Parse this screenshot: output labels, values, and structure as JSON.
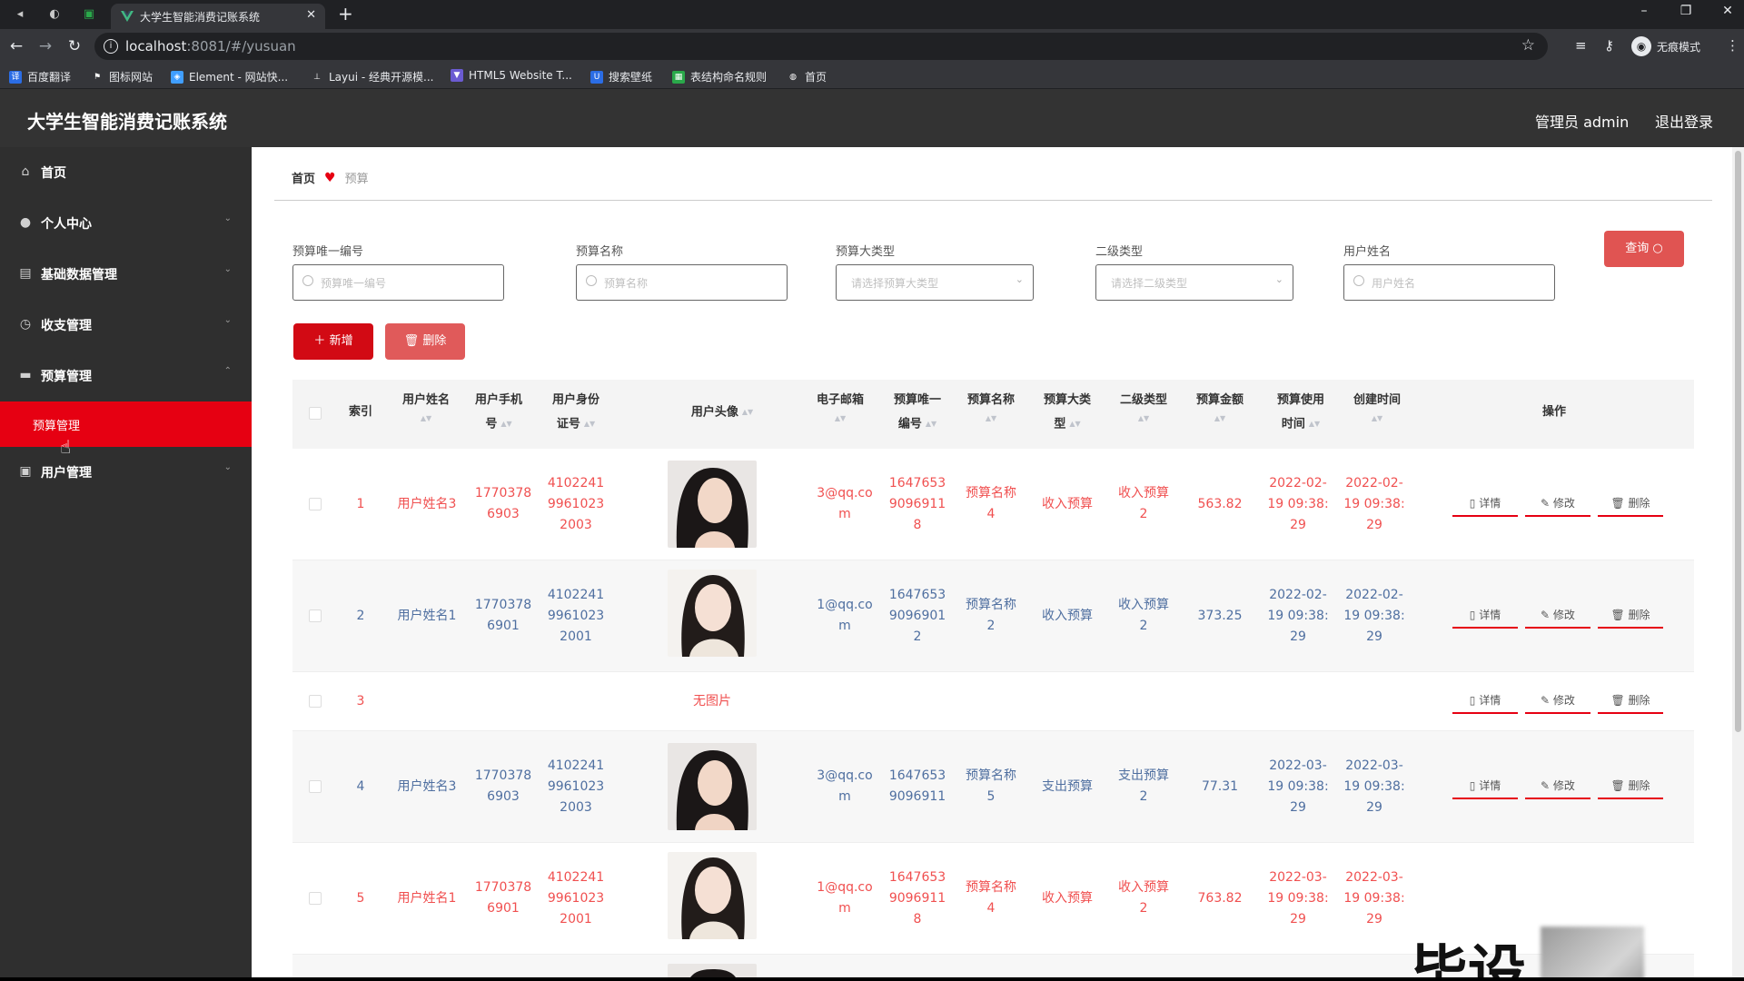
{
  "browser": {
    "tab_title": "大学生智能消费记账系统",
    "url_host": "localhost",
    "url_rest": ":8081/#/yusuan",
    "incognito_label": "无痕模式",
    "bookmarks": [
      "百度翻译",
      "图标网站",
      "Element - 网站快...",
      "Layui - 经典开源模...",
      "HTML5 Website T...",
      "搜索壁纸",
      "表结构命名规则",
      "首页"
    ]
  },
  "header": {
    "title": "大学生智能消费记账系统",
    "admin": "管理员 admin",
    "logout": "退出登录"
  },
  "sidebar": {
    "items": [
      {
        "label": "首页",
        "icon": "home-icon"
      },
      {
        "label": "个人中心",
        "icon": "user-icon"
      },
      {
        "label": "基础数据管理",
        "icon": "database-icon"
      },
      {
        "label": "收支管理",
        "icon": "clock-icon"
      },
      {
        "label": "预算管理",
        "icon": "chat-icon"
      },
      {
        "label": "用户管理",
        "icon": "user-manage-icon"
      }
    ],
    "active_sub": "预算管理"
  },
  "breadcrumb": {
    "home": "首页",
    "current": "预算"
  },
  "filters": {
    "f1_label": "预算唯一编号",
    "f1_ph": "预算唯一编号",
    "f2_label": "预算名称",
    "f2_ph": "预算名称",
    "f3_label": "预算大类型",
    "f3_ph": "请选择预算大类型",
    "f4_label": "二级类型",
    "f4_ph": "请选择二级类型",
    "f5_label": "用户姓名",
    "f5_ph": "用户姓名",
    "query": "查询"
  },
  "actions": {
    "add": "新增",
    "delete": "删除"
  },
  "table": {
    "headers": {
      "index": "索引",
      "name_1": "用户姓名",
      "phone_1": "用户手机",
      "phone_2": "号",
      "id_1": "用户身份",
      "id_2": "证号",
      "avatar": "用户头像",
      "email": "电子邮箱",
      "uid_1": "预算唯一",
      "uid_2": "编号",
      "bname": "预算名称",
      "btype_1": "预算大类",
      "btype_2": "型",
      "sub": "二级类型",
      "amount": "预算金额",
      "usetime_1": "预算使用",
      "usetime_2": "时间",
      "created": "创建时间",
      "ops": "操作"
    },
    "op_labels": {
      "detail": "详情",
      "edit": "修改",
      "delete": "删除"
    },
    "rows": [
      {
        "index": "1",
        "name": "用户姓名3",
        "phone_a": "1770378",
        "phone_b": "6903",
        "id_a": "4102241",
        "id_b": "9961023",
        "id_c": "2003",
        "email_a": "3@qq.co",
        "email_b": "m",
        "uid_a": "1647653",
        "uid_b": "9096911",
        "uid_c": "8",
        "bname_a": "预算名称",
        "bname_b": "4",
        "btype": "收入预算",
        "sub_a": "收入预算",
        "sub_b": "2",
        "amount": "563.82",
        "use_a": "2022-02-",
        "use_b": "19 09:38:",
        "use_c": "29",
        "cr_a": "2022-02-",
        "cr_b": "19 09:38:",
        "cr_c": "29"
      },
      {
        "index": "2",
        "name": "用户姓名1",
        "phone_a": "1770378",
        "phone_b": "6901",
        "id_a": "4102241",
        "id_b": "9961023",
        "id_c": "2001",
        "email_a": "1@qq.co",
        "email_b": "m",
        "uid_a": "1647653",
        "uid_b": "9096901",
        "uid_c": "2",
        "bname_a": "预算名称",
        "bname_b": "2",
        "btype": "收入预算",
        "sub_a": "收入预算",
        "sub_b": "2",
        "amount": "373.25",
        "use_a": "2022-02-",
        "use_b": "19 09:38:",
        "use_c": "29",
        "cr_a": "2022-02-",
        "cr_b": "19 09:38:",
        "cr_c": "29"
      },
      {
        "index": "3",
        "no_image": "无图片"
      },
      {
        "index": "4",
        "name": "用户姓名3",
        "phone_a": "1770378",
        "phone_b": "6903",
        "id_a": "4102241",
        "id_b": "9961023",
        "id_c": "2003",
        "email_a": "3@qq.co",
        "email_b": "m",
        "uid_a": "1647653",
        "uid_b": "9096911",
        "uid_c": "",
        "bname_a": "预算名称",
        "bname_b": "5",
        "btype": "支出预算",
        "sub_a": "支出预算",
        "sub_b": "2",
        "amount": "77.31",
        "use_a": "2022-03-",
        "use_b": "19 09:38:",
        "use_c": "29",
        "cr_a": "2022-03-",
        "cr_b": "19 09:38:",
        "cr_c": "29"
      },
      {
        "index": "5",
        "name": "用户姓名1",
        "phone_a": "1770378",
        "phone_b": "6901",
        "id_a": "4102241",
        "id_b": "9961023",
        "id_c": "2001",
        "email_a": "1@qq.co",
        "email_b": "m",
        "uid_a": "1647653",
        "uid_b": "9096911",
        "uid_c": "8",
        "bname_a": "预算名称",
        "bname_b": "4",
        "btype": "收入预算",
        "sub_a": "收入预算",
        "sub_b": "2",
        "amount": "763.82",
        "use_a": "2022-03-",
        "use_b": "19 09:38:",
        "use_c": "29",
        "cr_a": "2022-03-",
        "cr_b": "19 09:38:",
        "cr_c": "29"
      }
    ]
  },
  "watermark": "毕设"
}
